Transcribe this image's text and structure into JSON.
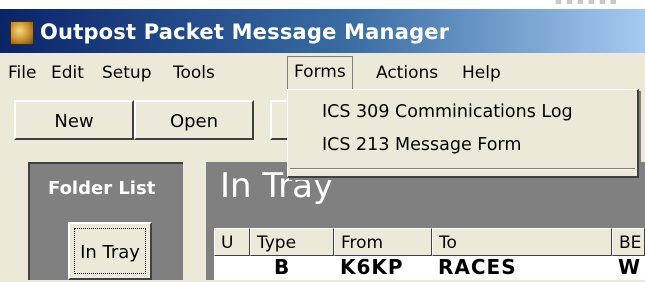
{
  "window": {
    "title": "Outpost Packet Message Manager"
  },
  "menubar": {
    "items": [
      {
        "label": "File"
      },
      {
        "label": "Edit"
      },
      {
        "label": "Setup"
      },
      {
        "label": "Tools"
      },
      {
        "label": "Forms",
        "active": true
      },
      {
        "label": "Actions"
      },
      {
        "label": "Help"
      }
    ]
  },
  "forms_menu": {
    "items": [
      {
        "label": "ICS 309 Comminications Log"
      },
      {
        "label": "ICS 213 Message Form"
      }
    ]
  },
  "toolbar": {
    "new_label": "New",
    "open_label": "Open"
  },
  "folder_panel": {
    "header": "Folder List",
    "in_tray_button": "In Tray"
  },
  "main": {
    "header": "In Tray",
    "columns": [
      "U",
      "Type",
      "From",
      "To",
      "BE"
    ],
    "rows": [
      {
        "u": "",
        "type": "B",
        "from": "K6KP",
        "to": "RACES",
        "be": "W"
      }
    ]
  },
  "colors": {
    "title_gradient_start": "#0a246a",
    "title_gradient_end": "#a6caf0",
    "panel_gray": "#808080",
    "face": "#ece9d8"
  }
}
